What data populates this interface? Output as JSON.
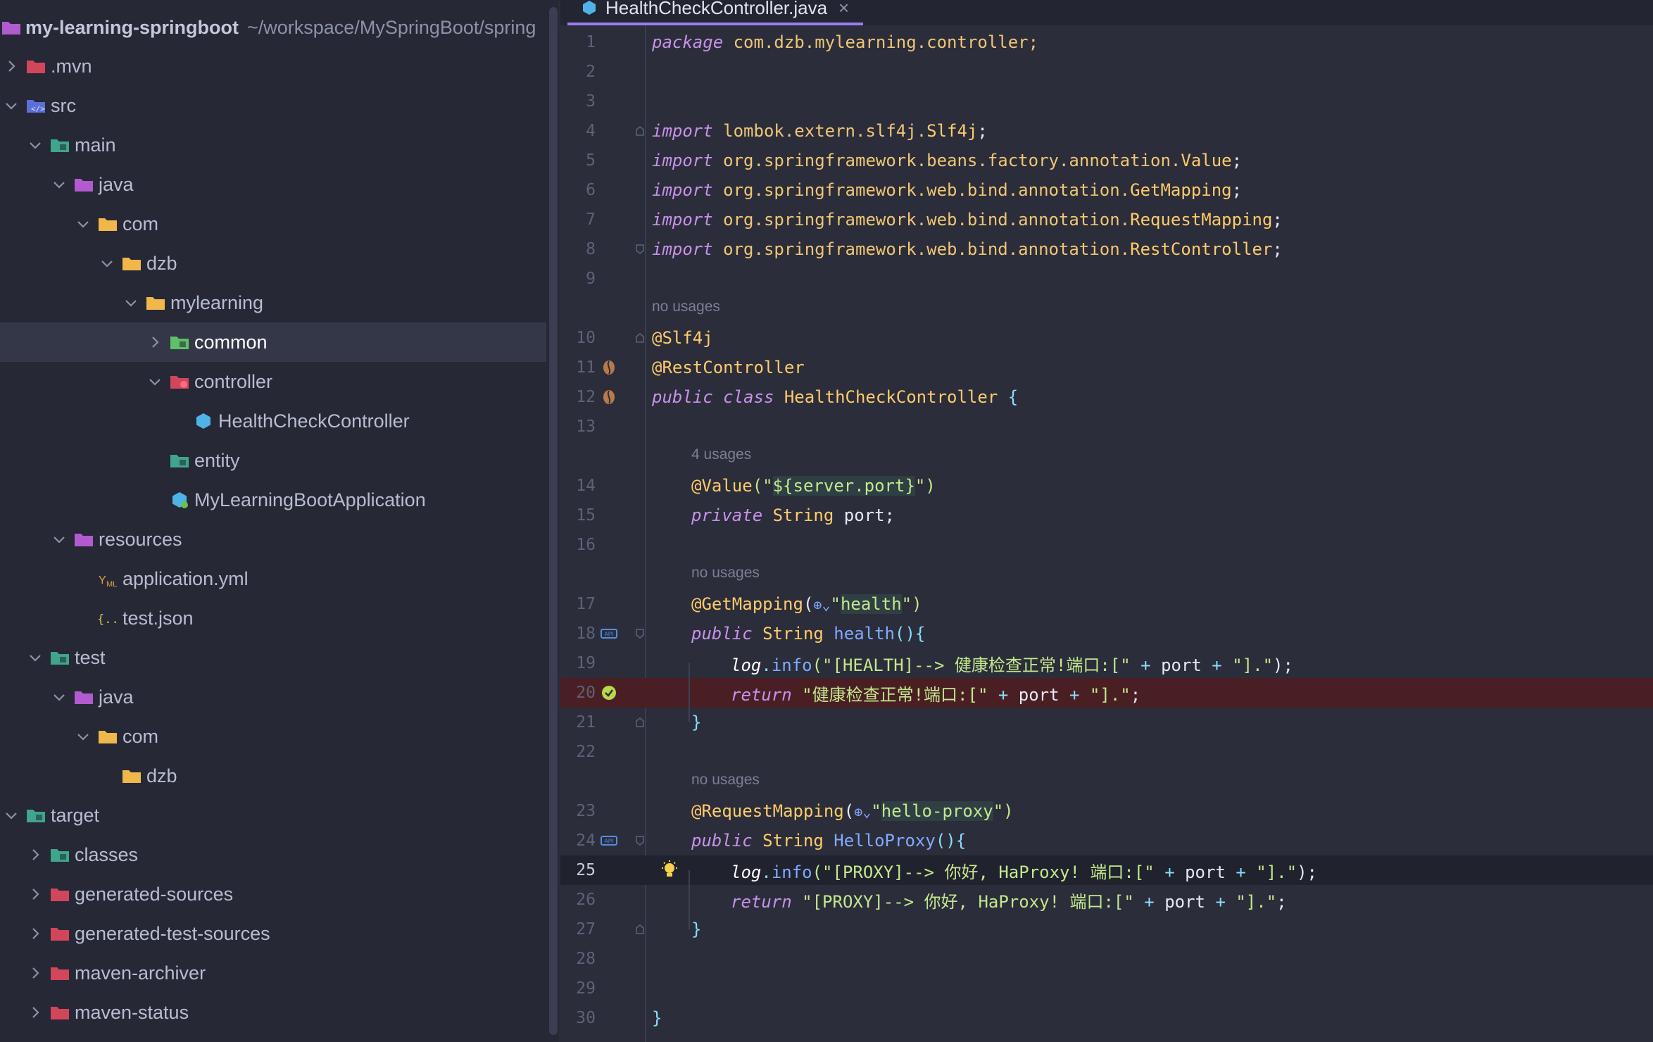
{
  "project": {
    "name": "my-learning-springboot",
    "path": "~/workspace/MySpringBoot/spring"
  },
  "tree": [
    {
      "label": ".mvn",
      "depth": 0,
      "chevron": "right",
      "icon": "folder-maven-icon",
      "color": "#d2465c"
    },
    {
      "label": "src",
      "depth": 0,
      "chevron": "down",
      "icon": "folder-source-icon",
      "color": "#5a6fd8"
    },
    {
      "label": "main",
      "depth": 1,
      "chevron": "down",
      "icon": "folder-module-icon",
      "color": "#3fa58d"
    },
    {
      "label": "java",
      "depth": 2,
      "chevron": "down",
      "icon": "folder-java-icon",
      "color": "#b25ad0"
    },
    {
      "label": "com",
      "depth": 3,
      "chevron": "down",
      "icon": "folder-icon",
      "color": "#f0b74a"
    },
    {
      "label": "dzb",
      "depth": 4,
      "chevron": "down",
      "icon": "folder-icon",
      "color": "#f0b74a"
    },
    {
      "label": "mylearning",
      "depth": 5,
      "chevron": "down",
      "icon": "folder-icon",
      "color": "#f0b74a"
    },
    {
      "label": "common",
      "depth": 6,
      "chevron": "right",
      "icon": "folder-common-icon",
      "color": "#5fbf6a",
      "selected": true
    },
    {
      "label": "controller",
      "depth": 6,
      "chevron": "down",
      "icon": "folder-controller-icon",
      "color": "#d2465c"
    },
    {
      "label": "HealthCheckController",
      "depth": 7,
      "chevron": "none",
      "icon": "java-class-icon",
      "color": "#4fb3e8"
    },
    {
      "label": "entity",
      "depth": 6,
      "chevron": "none",
      "icon": "folder-entity-icon",
      "color": "#3fa58d"
    },
    {
      "label": "MyLearningBootApplication",
      "depth": 6,
      "chevron": "none",
      "icon": "spring-app-icon",
      "color": "#4fb3e8"
    },
    {
      "label": "resources",
      "depth": 2,
      "chevron": "down",
      "icon": "folder-resources-icon",
      "color": "#b25ad0"
    },
    {
      "label": "application.yml",
      "depth": 3,
      "chevron": "none",
      "icon": "yaml-file-icon",
      "color": "#e0a341"
    },
    {
      "label": "test.json",
      "depth": 3,
      "chevron": "none",
      "icon": "json-file-icon",
      "color": "#d8c24a"
    },
    {
      "label": "test",
      "depth": 1,
      "chevron": "down",
      "icon": "folder-test-icon",
      "color": "#3fa58d"
    },
    {
      "label": "java",
      "depth": 2,
      "chevron": "down",
      "icon": "folder-java-icon",
      "color": "#b25ad0"
    },
    {
      "label": "com",
      "depth": 3,
      "chevron": "down",
      "icon": "folder-icon",
      "color": "#f0b74a"
    },
    {
      "label": "dzb",
      "depth": 4,
      "chevron": "none",
      "icon": "folder-icon",
      "color": "#f0b74a"
    },
    {
      "label": "target",
      "depth": 0,
      "chevron": "down",
      "icon": "folder-target-icon",
      "color": "#3fa58d"
    },
    {
      "label": "classes",
      "depth": 1,
      "chevron": "right",
      "icon": "folder-classes-icon",
      "color": "#3fa58d"
    },
    {
      "label": "generated-sources",
      "depth": 1,
      "chevron": "right",
      "icon": "folder-red-icon",
      "color": "#d2465c"
    },
    {
      "label": "generated-test-sources",
      "depth": 1,
      "chevron": "right",
      "icon": "folder-red-icon",
      "color": "#d2465c"
    },
    {
      "label": "maven-archiver",
      "depth": 1,
      "chevron": "right",
      "icon": "folder-red-icon",
      "color": "#d2465c"
    },
    {
      "label": "maven-status",
      "depth": 1,
      "chevron": "right",
      "icon": "folder-red-icon",
      "color": "#d2465c"
    }
  ],
  "editor": {
    "tab_label": "HealthCheckController.java",
    "tab_close": "×",
    "hints": {
      "h1": "no usages",
      "h2": "4 usages",
      "h3": "no usages",
      "h4": "no usages"
    },
    "line_numbers": [
      "1",
      "2",
      "3",
      "4",
      "5",
      "6",
      "7",
      "8",
      "9",
      "10",
      "11",
      "12",
      "13",
      "14",
      "15",
      "16",
      "17",
      "18",
      "19",
      "20",
      "21",
      "22",
      "23",
      "24",
      "25",
      "26",
      "27",
      "28",
      "29",
      "30"
    ],
    "code": {
      "l1": [
        "package",
        " com.dzb.mylearning.controller;"
      ],
      "l4": [
        "import",
        " lombok.extern.slf4j.",
        "Slf4j",
        ";"
      ],
      "l5": [
        "import",
        " org.springframework.beans.factory.annotation.",
        "Value",
        ";"
      ],
      "l6": [
        "import",
        " org.springframework.web.bind.annotation.",
        "GetMapping",
        ";"
      ],
      "l7": [
        "import",
        " org.springframework.web.bind.annotation.",
        "RequestMapping",
        ";"
      ],
      "l8": [
        "import",
        " org.springframework.web.bind.annotation.",
        "RestController",
        ";"
      ],
      "l10": [
        "@Slf4j"
      ],
      "l11": [
        "@RestController"
      ],
      "l12": [
        "public class",
        " HealthCheckController",
        " {"
      ],
      "l14": [
        "@Value",
        "(\"",
        "${",
        "server.port",
        "}",
        "\")"
      ],
      "l15": [
        "private",
        " String",
        " port;"
      ],
      "l17": [
        "@GetMapping",
        "(",
        "\"",
        "health",
        "\")"
      ],
      "l18": [
        "public",
        " String",
        " health",
        "(){"
      ],
      "l19": [
        "log",
        ".",
        "info",
        "(\"[HEALTH]--> 健康检查正常!端口:[\"",
        " + ",
        "port",
        " + ",
        "\"].\"",
        ");"
      ],
      "l20": [
        "return",
        " \"健康检查正常!端口:[\"",
        " + ",
        "port",
        " + ",
        "\"].\"",
        ";"
      ],
      "l21": [
        "}"
      ],
      "l23": [
        "@RequestMapping",
        "(",
        "\"",
        "hello-proxy",
        "\")"
      ],
      "l24": [
        "public",
        " String",
        " HelloProxy",
        "(){"
      ],
      "l25": [
        "log",
        ".",
        "info",
        "(\"[PROXY]--> 你好, HaProxy! 端口:[\"",
        " + ",
        "port",
        " + ",
        "\"].\"",
        ");"
      ],
      "l26": [
        "return",
        " \"[PROXY]--> 你好, HaProxy! 端口:[\"",
        " + ",
        "port",
        " + ",
        "\"].\"",
        ";"
      ],
      "l27": [
        "}"
      ],
      "l30": [
        "}"
      ]
    }
  }
}
